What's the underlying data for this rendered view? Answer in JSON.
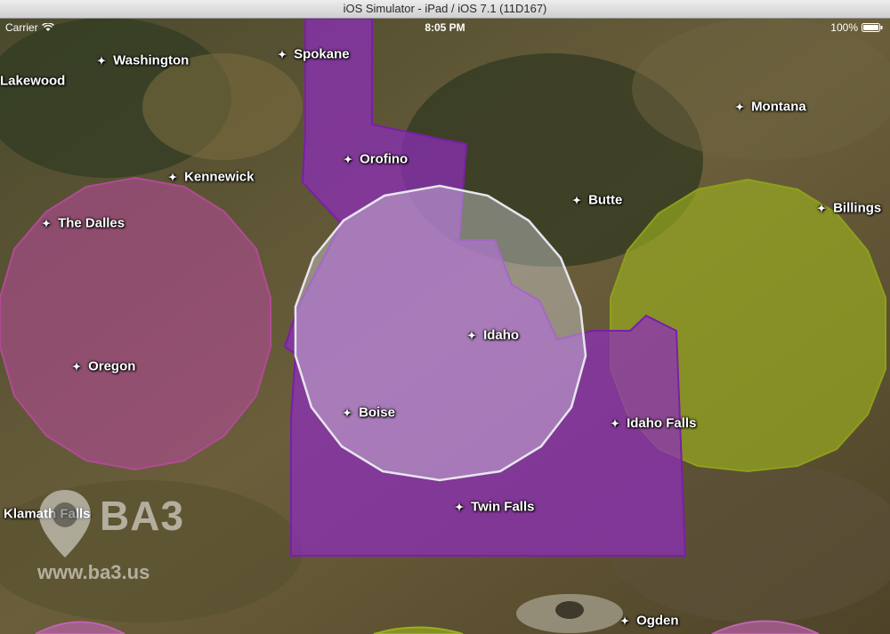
{
  "window": {
    "title": "iOS Simulator - iPad / iOS 7.1 (11D167)"
  },
  "status_bar": {
    "carrier": "Carrier",
    "time": "8:05 PM",
    "battery": "100%"
  },
  "colors": {
    "idaho_fill": "#8e2cbd",
    "circle_pink": "#b04b93",
    "circle_green": "#9bb01e",
    "circle_white": "#d8d8e0"
  },
  "places": [
    {
      "name": "Washington"
    },
    {
      "name": "Spokane"
    },
    {
      "name": "Lakewood"
    },
    {
      "name": "Montana"
    },
    {
      "name": "Orofino"
    },
    {
      "name": "Kennewick"
    },
    {
      "name": "Butte"
    },
    {
      "name": "Billings"
    },
    {
      "name": "The Dalles"
    },
    {
      "name": "Idaho"
    },
    {
      "name": "Oregon"
    },
    {
      "name": "Boise"
    },
    {
      "name": "Idaho Falls"
    },
    {
      "name": "Twin Falls"
    },
    {
      "name": "Klamath Falls"
    },
    {
      "name": "Ogden"
    }
  ],
  "watermark": {
    "brand": "BA3",
    "url": "www.ba3.us"
  }
}
